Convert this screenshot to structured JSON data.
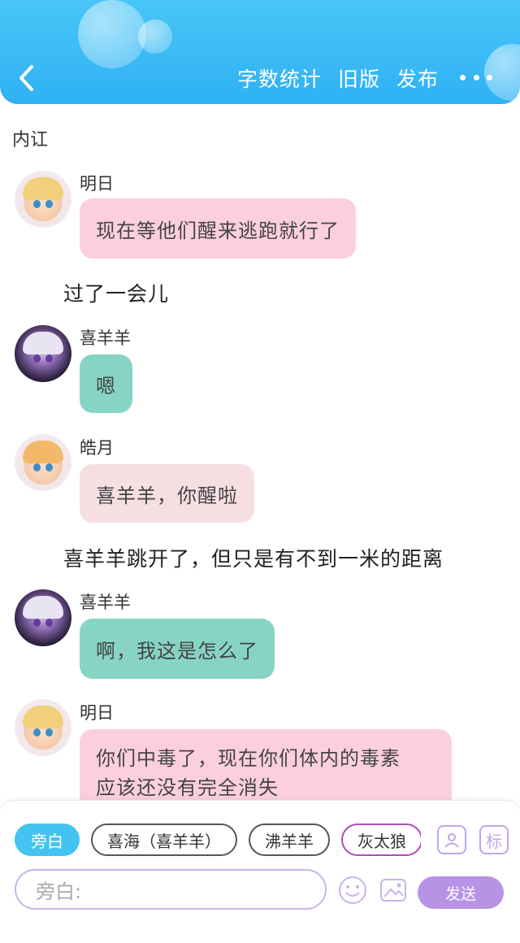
{
  "header": {
    "word_count": "字数统计",
    "old_version": "旧版",
    "publish": "发布"
  },
  "chat": {
    "topic": "内讧",
    "messages": [
      {
        "sender": "明日",
        "text": "现在等他们醒来逃跑就行了"
      },
      {
        "narration": "过了一会儿"
      },
      {
        "sender": "喜羊羊",
        "text": "嗯"
      },
      {
        "sender": "皓月",
        "text": "喜羊羊，你醒啦"
      },
      {
        "narration": "喜羊羊跳开了，但只是有不到一米的距离"
      },
      {
        "sender": "喜羊羊",
        "text": "啊，我这是怎么了"
      },
      {
        "sender": "明日",
        "line1": "你们中毒了，现在你们体内的毒素",
        "line2": "应该还没有完全消失"
      }
    ]
  },
  "composer": {
    "roles": [
      "旁白",
      "喜海（喜羊羊）",
      "沸羊羊",
      "灰太狼"
    ],
    "mark_label": "标",
    "placeholder": "旁白:",
    "send_label": "发送"
  },
  "colors": {
    "header_blue": "#2fb1f3",
    "pink_bubble": "#fbcfdc",
    "teal_bubble": "#87d4c5",
    "send_purple": "#b793e6"
  }
}
